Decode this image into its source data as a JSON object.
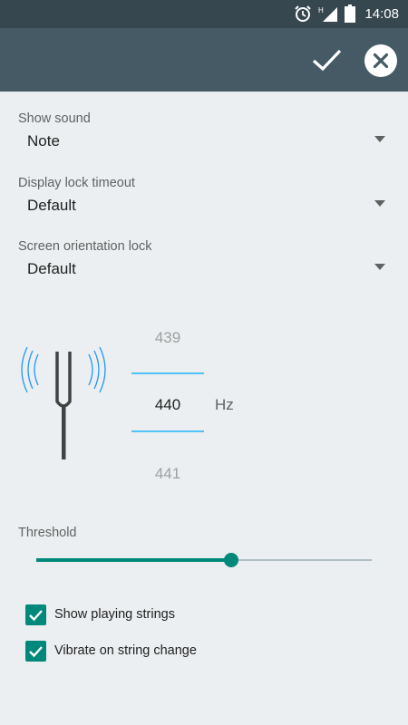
{
  "status_bar": {
    "time": "14:08",
    "network_label": "H"
  },
  "action_bar": {
    "confirm_icon": "check-icon",
    "close_icon": "close-circle-icon"
  },
  "settings": [
    {
      "label": "Show sound",
      "value": "Note"
    },
    {
      "label": "Display lock timeout",
      "value": "Default"
    },
    {
      "label": "Screen orientation lock",
      "value": "Default"
    }
  ],
  "frequency": {
    "previous": "439",
    "current": "440",
    "next": "441",
    "unit": "Hz"
  },
  "threshold": {
    "label": "Threshold",
    "level": 0.58,
    "accent": "#00897b"
  },
  "checkboxes": [
    {
      "label": "Show playing strings",
      "checked": true
    },
    {
      "label": "Vibrate on string change",
      "checked": true
    }
  ],
  "colors": {
    "header": "#455a64",
    "status": "#37474f",
    "accent": "#00897b",
    "picker_line": "#4fc3f7",
    "background": "#eceff1"
  }
}
